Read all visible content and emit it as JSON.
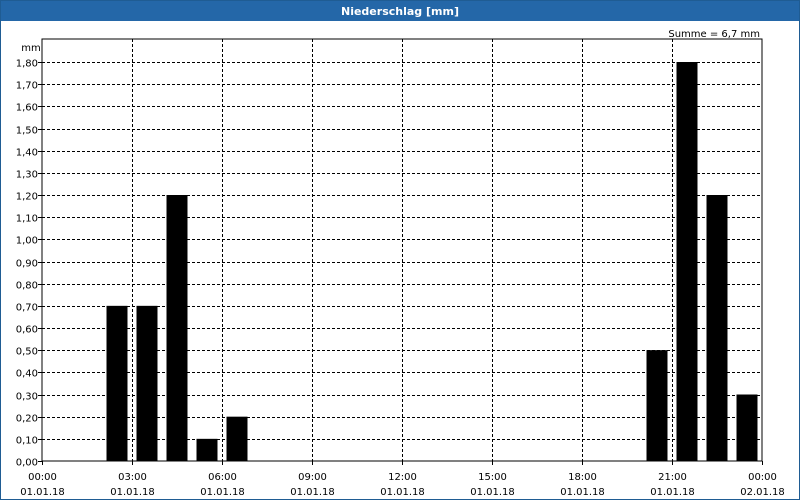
{
  "window": {
    "title": "Niederschlag [mm]"
  },
  "summary": {
    "text": "Summe = 6,7 mm"
  },
  "chart_data": {
    "type": "bar",
    "title": "Niederschlag [mm]",
    "ylabel": "mm",
    "xlabel": "",
    "ylim": [
      0,
      1.8
    ],
    "xlim_hours": [
      0,
      24
    ],
    "grid": true,
    "bar_color": "#000000",
    "y_ticks": [
      "0,00",
      "0,10",
      "0,20",
      "0,30",
      "0,40",
      "0,50",
      "0,60",
      "0,70",
      "0,80",
      "0,90",
      "1,00",
      "1,10",
      "1,20",
      "1,30",
      "1,40",
      "1,50",
      "1,60",
      "1,70",
      "1,80"
    ],
    "x_ticks": [
      {
        "time": "00:00",
        "date": "01.01.18"
      },
      {
        "time": "03:00",
        "date": "01.01.18"
      },
      {
        "time": "06:00",
        "date": "01.01.18"
      },
      {
        "time": "09:00",
        "date": "01.01.18"
      },
      {
        "time": "12:00",
        "date": "01.01.18"
      },
      {
        "time": "15:00",
        "date": "01.01.18"
      },
      {
        "time": "18:00",
        "date": "01.01.18"
      },
      {
        "time": "21:00",
        "date": "01.01.18"
      },
      {
        "time": "00:00",
        "date": "02.01.18"
      }
    ],
    "bars": [
      {
        "hour": 3,
        "value": 0.7
      },
      {
        "hour": 4,
        "value": 0.7
      },
      {
        "hour": 5,
        "value": 1.2
      },
      {
        "hour": 6,
        "value": 0.1
      },
      {
        "hour": 7,
        "value": 0.2
      },
      {
        "hour": 21,
        "value": 0.5
      },
      {
        "hour": 22,
        "value": 1.8
      },
      {
        "hour": 23,
        "value": 1.2
      },
      {
        "hour": 24,
        "value": 0.3
      }
    ]
  }
}
